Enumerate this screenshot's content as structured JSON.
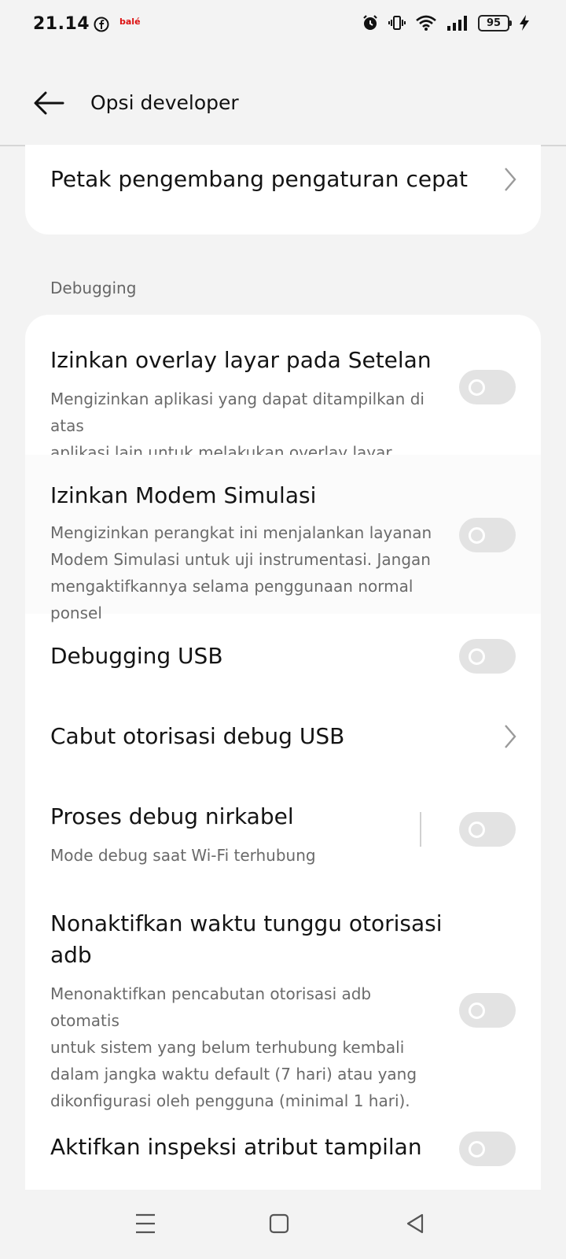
{
  "status_bar": {
    "time": "21.14",
    "left_icons": [
      "facebook-icon",
      "bale-icon"
    ],
    "bale_label": "balé",
    "right_icons": [
      "alarm-icon",
      "vibrate-icon",
      "wifi-icon",
      "signal-icon",
      "battery-icon",
      "charging-icon"
    ],
    "battery_level": "95"
  },
  "app_bar": {
    "back_icon": "arrow-left-icon",
    "title": "Opsi developer"
  },
  "top_item": {
    "title": "Petak pengembang pengaturan cepat",
    "icon": "chevron-right-icon"
  },
  "section": {
    "label": "Debugging"
  },
  "items": [
    {
      "title": "Izinkan overlay layar pada Setelan",
      "subtitle_lines": [
        "Mengizinkan aplikasi yang dapat ditampilkan di atas",
        "aplikasi lain untuk melakukan overlay layar Setelan"
      ],
      "control": "toggle",
      "enabled": false
    },
    {
      "title": "Izinkan Modem Simulasi",
      "subtitle_lines": [
        "Mengizinkan perangkat ini menjalankan layanan",
        "Modem Simulasi untuk uji instrumentasi. Jangan",
        "mengaktifkannya selama penggunaan normal ponsel"
      ],
      "control": "toggle",
      "enabled": false
    },
    {
      "title": "Debugging USB",
      "control": "toggle",
      "enabled": false
    },
    {
      "title": "Cabut otorisasi debug USB",
      "control": "chevron"
    },
    {
      "title": "Proses debug nirkabel",
      "subtitle_lines": [
        "Mode debug saat Wi-Fi terhubung"
      ],
      "control": "toggle",
      "enabled": false
    },
    {
      "title_lines": [
        "Nonaktifkan waktu tunggu otorisasi",
        "adb"
      ],
      "subtitle_lines": [
        "Menonaktifkan pencabutan otorisasi adb otomatis",
        "untuk sistem yang belum terhubung kembali",
        "dalam jangka waktu default (7 hari) atau yang",
        "dikonfigurasi oleh pengguna (minimal 1 hari)."
      ],
      "control": "toggle",
      "enabled": false
    },
    {
      "title": "Aktifkan inspeksi atribut tampilan",
      "control": "toggle",
      "enabled": false
    }
  ],
  "nav_bar": {
    "icons": [
      "menu-icon",
      "home-icon",
      "back-triangle-icon"
    ]
  },
  "colors": {
    "background": "#f3f3f3",
    "card": "#ffffff",
    "toggle_off": "#e3e3e3",
    "secondary_text": "#6a6a6a"
  }
}
